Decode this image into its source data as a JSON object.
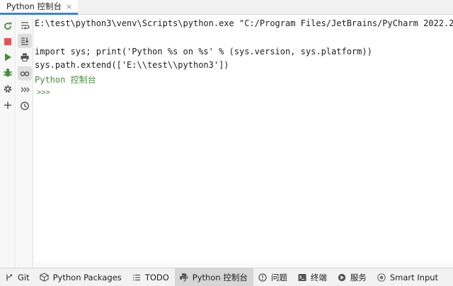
{
  "tab": {
    "label": "Python 控制台",
    "close": "×"
  },
  "console": {
    "lines": [
      "E:\\test\\python3\\venv\\Scripts\\python.exe \"C:/Program Files/JetBrains/PyCharm 2022.2.",
      "import sys; print('Python %s on %s' % (sys.version, sys.platform))",
      "sys.path.extend(['E:\\\\test\\\\python3'])"
    ],
    "banner_name": "Python",
    "banner_label": "控制台",
    "prompt": ">>>"
  },
  "left_toolbar": {
    "icons": [
      "rerun-icon",
      "stop-icon",
      "run-icon",
      "debug-icon",
      "settings-icon",
      "add-icon"
    ]
  },
  "second_toolbar": {
    "icons": [
      "soft-wrap-icon",
      "scroll-to-end-icon",
      "print-icon",
      "variables-view-icon",
      "execute-icon",
      "history-icon"
    ]
  },
  "bottom_bar": {
    "items": [
      {
        "label": "Git",
        "icon": "git-branch-icon"
      },
      {
        "label": "Python Packages",
        "icon": "packages-icon"
      },
      {
        "label": "TODO",
        "icon": "todo-list-icon"
      },
      {
        "label": "Python 控制台",
        "icon": "python-console-icon",
        "active": true
      },
      {
        "label": "问题",
        "icon": "problems-icon"
      },
      {
        "label": "终端",
        "icon": "terminal-icon"
      },
      {
        "label": "服务",
        "icon": "services-icon"
      },
      {
        "label": "Smart Input",
        "icon": "smart-input-icon"
      }
    ]
  },
  "colors": {
    "accent": "#4083c9",
    "green": "#4a8c3f",
    "stop_red": "#e05555",
    "text": "#1e1e1e"
  }
}
